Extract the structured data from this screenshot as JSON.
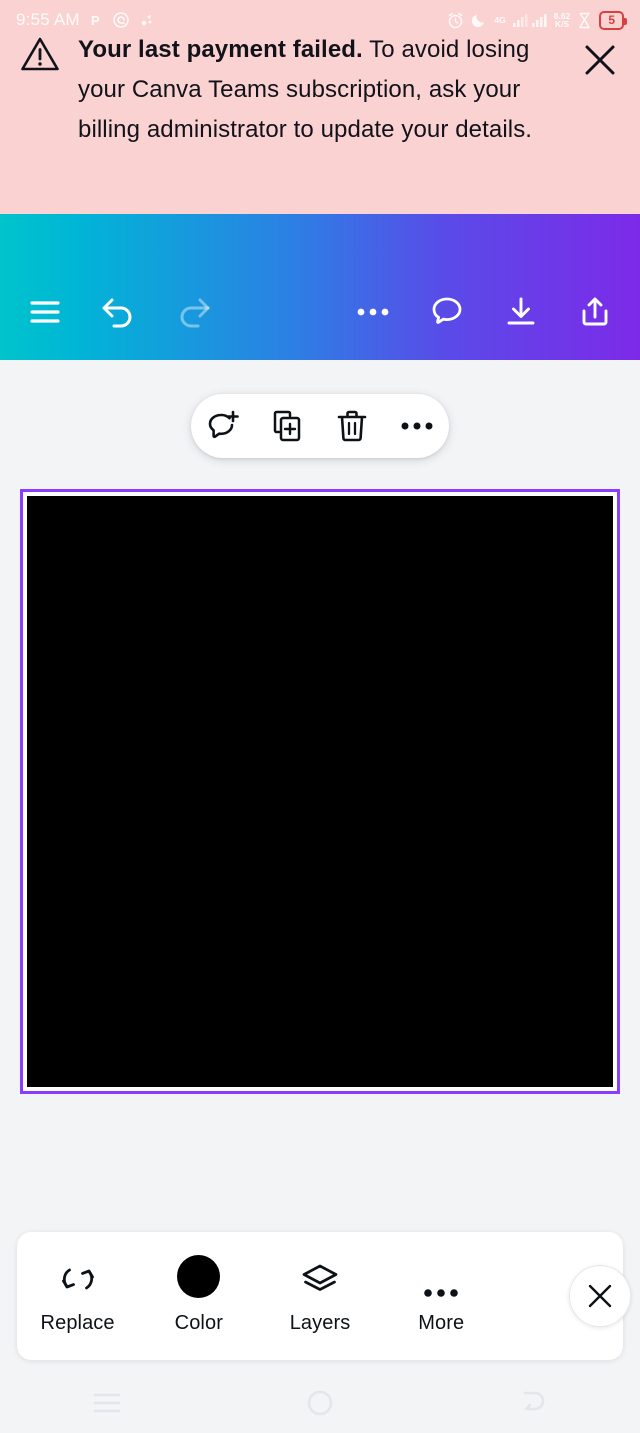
{
  "status_bar": {
    "time": "9:55 AM",
    "app_icons": [
      "p-letter-icon",
      "target-spiral-icon",
      "dot-cluster-icon"
    ],
    "alarm_icon": "alarm-clock-icon",
    "dnd_icon": "moon-icon",
    "network_type": "4G",
    "data_rate_value": "8.62",
    "data_rate_unit": "K/S",
    "battery_saver_icon": "battery-saver-icon",
    "battery_level": "5"
  },
  "banner": {
    "warning_icon": "warning-triangle-icon",
    "bold_text": "Your last payment failed.",
    "body_text": " To avoid losing your Canva Teams subscription, ask your billing administrator to update your details.",
    "close_icon": "close-icon",
    "background_color": "#fad2d2"
  },
  "toolbar": {
    "gradient_start": "#00c4cc",
    "gradient_mid": "#2d7fe4",
    "gradient_end": "#7d2ae8",
    "menu_icon": "hamburger-menu-icon",
    "undo_icon": "undo-icon",
    "redo_icon": "redo-icon",
    "more_icon": "more-horizontal-icon",
    "comment_icon": "comment-bubble-icon",
    "download_icon": "download-icon",
    "share_icon": "share-upload-icon"
  },
  "context_pill": {
    "comment_icon": "add-comment-icon",
    "duplicate_icon": "duplicate-icon",
    "delete_icon": "trash-icon",
    "more_icon": "more-horizontal-icon"
  },
  "canvas": {
    "selection_color": "#8b3dff",
    "element_fill_color": "#000000"
  },
  "bottom_bar": {
    "items": [
      {
        "label": "Replace",
        "icon": "replace-swap-icon"
      },
      {
        "label": "Color",
        "icon": "color-swatch-icon"
      },
      {
        "label": "Layers",
        "icon": "layers-icon"
      },
      {
        "label": "More",
        "icon": "more-horizontal-icon"
      }
    ],
    "close_icon": "close-icon"
  },
  "nav_bar": {
    "recents_icon": "recents-icon",
    "home_icon": "home-circle-icon",
    "back_icon": "back-arrow-icon"
  }
}
